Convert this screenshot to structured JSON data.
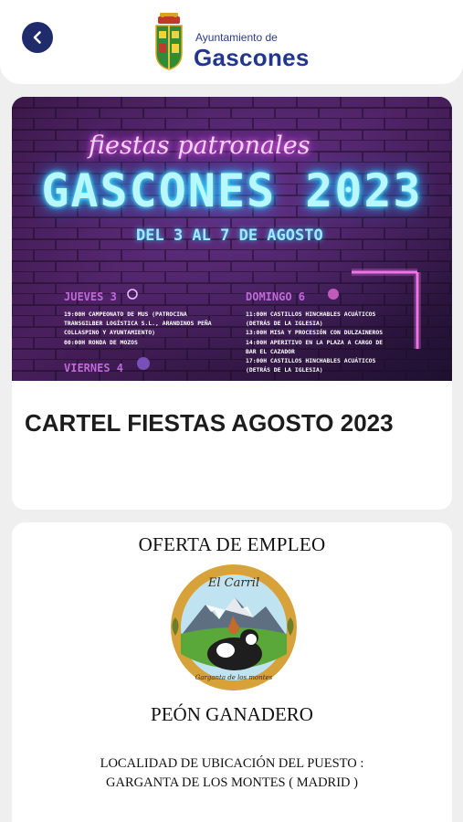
{
  "header": {
    "brand_top": "Ayuntamiento de",
    "brand_main": "Gascones",
    "back_icon": "chevron-left-icon",
    "accent_color": "#1f2b6b"
  },
  "posts": [
    {
      "poster": {
        "script_title": "fiestas patronales",
        "title": "GASCONES 2023",
        "dates": "DEL 3 AL 7 DE AGOSTO",
        "day_thursday": "JUEVES 3",
        "day_sunday": "DOMINGO 6",
        "day_friday": "VIERNES 4",
        "schedule_left": [
          "19:00H CAMPEONATO DE MUS (PATROCINA",
          "TRANSGILBER LOGÍSTICA S.L., ARANDINOS PEÑA",
          "COLLASPINO Y AYUNTAMIENTO)",
          "00:00H RONDA DE MOZOS"
        ],
        "schedule_right": [
          "11:00H CASTILLOS HINCHABLES ACUÁTICOS",
          "(DETRÁS DE LA IGLESIA)",
          "13:00H MISA Y PROCESIÓN CON DULZAINEROS",
          "14:00H APERITIVO EN LA PLAZA A CARGO DE",
          "BAR EL CAZADOR",
          "17:00H CASTILLOS HINCHABLES ACUÁTICOS",
          "(DETRÁS DE LA IGLESIA)"
        ]
      },
      "title": "CARTEL FIESTAS AGOSTO 2023"
    },
    {
      "heading": "OFERTA DE EMPLEO",
      "emblem_top": "El Carril",
      "emblem_bottom": "Garganta de los montes",
      "job_title": "PEÓN GANADERO",
      "location_label": "LOCALIDAD DE UBICACIÓN DEL PUESTO :",
      "location_value": "GARGANTA DE LOS MONTES ( MADRID )"
    }
  ]
}
